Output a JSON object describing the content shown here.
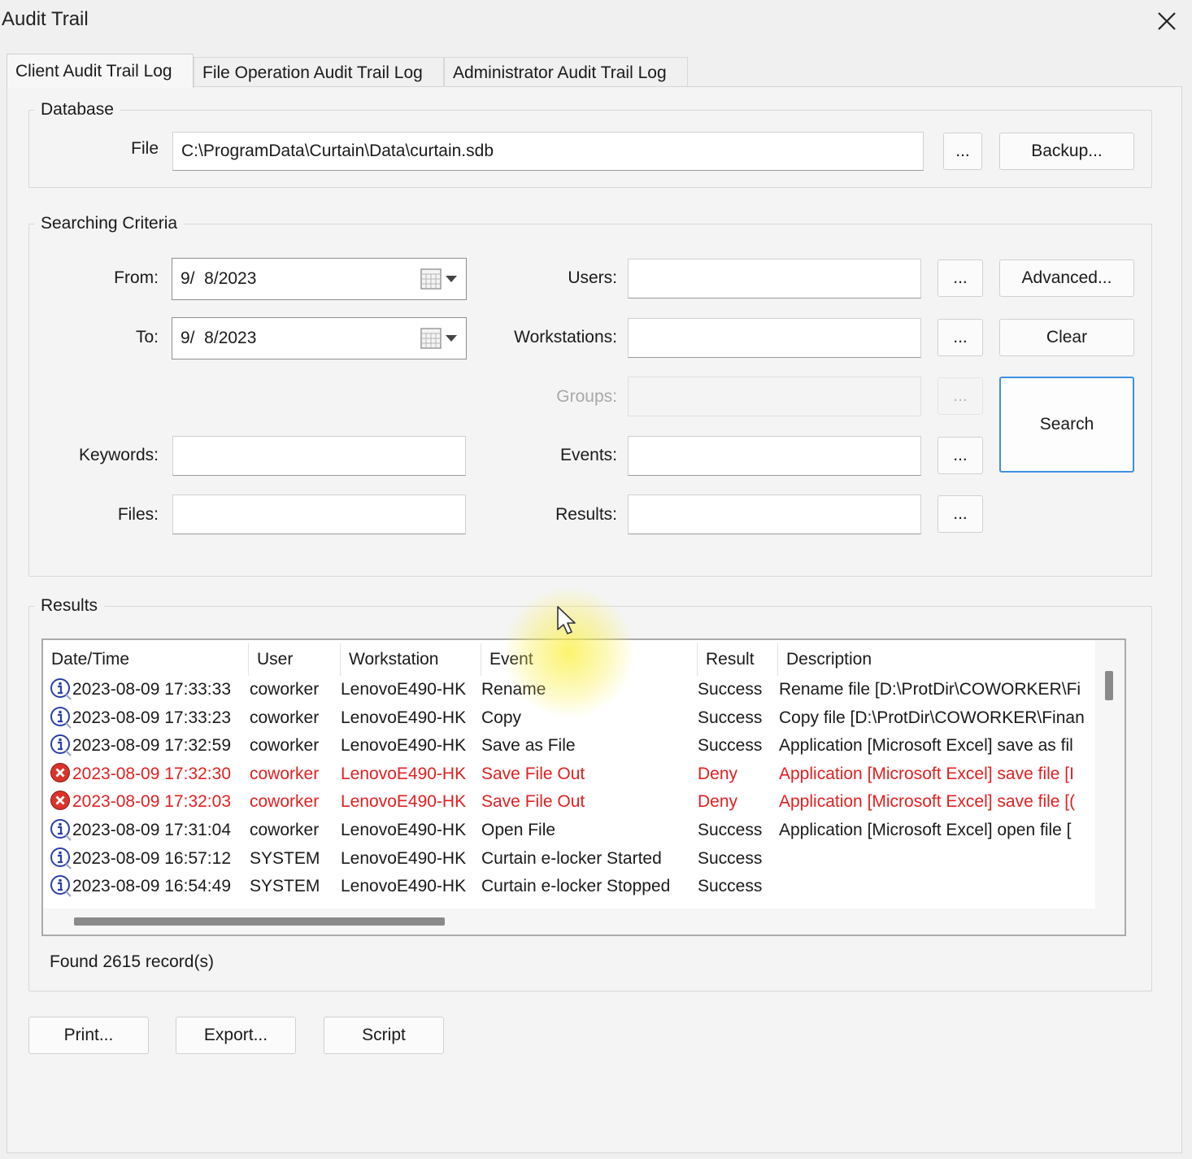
{
  "window": {
    "title": "Audit Trail"
  },
  "tabs": [
    {
      "label": "Client Audit Trail Log",
      "active": true
    },
    {
      "label": "File Operation Audit Trail Log",
      "active": false
    },
    {
      "label": "Administrator Audit Trail Log",
      "active": false
    }
  ],
  "database": {
    "legend": "Database",
    "file_label": "File",
    "file_value": "C:\\ProgramData\\Curtain\\Data\\curtain.sdb",
    "browse_label": "...",
    "backup_label": "Backup..."
  },
  "criteria": {
    "legend": "Searching Criteria",
    "from_label": "From:",
    "from_value": "9/  8/2023",
    "to_label": "To:",
    "to_value": "9/  8/2023",
    "keywords_label": "Keywords:",
    "keywords_value": "",
    "files_label": "Files:",
    "files_value": "",
    "users_label": "Users:",
    "workstations_label": "Workstations:",
    "groups_label": "Groups:",
    "events_label": "Events:",
    "results_label": "Results:",
    "ellipsis": "...",
    "advanced_label": "Advanced...",
    "clear_label": "Clear",
    "search_label": "Search"
  },
  "results": {
    "legend": "Results",
    "columns": [
      "Date/Time",
      "User",
      "Workstation",
      "Event",
      "Result",
      "Description"
    ],
    "rows": [
      {
        "type": "info",
        "datetime": "2023-08-09 17:33:33",
        "user": "coworker",
        "workstation": "LenovoE490-HK",
        "event": "Rename",
        "result": "Success",
        "description": "Rename file [D:\\ProtDir\\COWORKER\\Fi"
      },
      {
        "type": "info",
        "datetime": "2023-08-09 17:33:23",
        "user": "coworker",
        "workstation": "LenovoE490-HK",
        "event": "Copy",
        "result": "Success",
        "description": "Copy file [D:\\ProtDir\\COWORKER\\Finan"
      },
      {
        "type": "info",
        "datetime": "2023-08-09 17:32:59",
        "user": "coworker",
        "workstation": "LenovoE490-HK",
        "event": "Save as File",
        "result": "Success",
        "description": "Application [Microsoft Excel] save as fil"
      },
      {
        "type": "deny",
        "datetime": "2023-08-09 17:32:30",
        "user": "coworker",
        "workstation": "LenovoE490-HK",
        "event": "Save File Out",
        "result": "Deny",
        "description": "Application [Microsoft Excel] save file [I"
      },
      {
        "type": "deny",
        "datetime": "2023-08-09 17:32:03",
        "user": "coworker",
        "workstation": "LenovoE490-HK",
        "event": "Save File Out",
        "result": "Deny",
        "description": "Application [Microsoft Excel] save file [("
      },
      {
        "type": "info",
        "datetime": "2023-08-09 17:31:04",
        "user": "coworker",
        "workstation": "LenovoE490-HK",
        "event": "Open File",
        "result": "Success",
        "description": "Application [Microsoft Excel] open file ["
      },
      {
        "type": "info",
        "datetime": "2023-08-09 16:57:12",
        "user": "SYSTEM",
        "workstation": "LenovoE490-HK",
        "event": "Curtain e-locker Started",
        "result": "Success",
        "description": ""
      },
      {
        "type": "info",
        "datetime": "2023-08-09 16:54:49",
        "user": "SYSTEM",
        "workstation": "LenovoE490-HK",
        "event": "Curtain e-locker Stopped",
        "result": "Success",
        "description": ""
      }
    ],
    "found_text": "Found 2615 record(s)"
  },
  "footer": {
    "print_label": "Print...",
    "export_label": "Export...",
    "script_label": "Script"
  },
  "colors": {
    "deny_text": "#e02020",
    "default_button_border": "#3c8fe3"
  }
}
